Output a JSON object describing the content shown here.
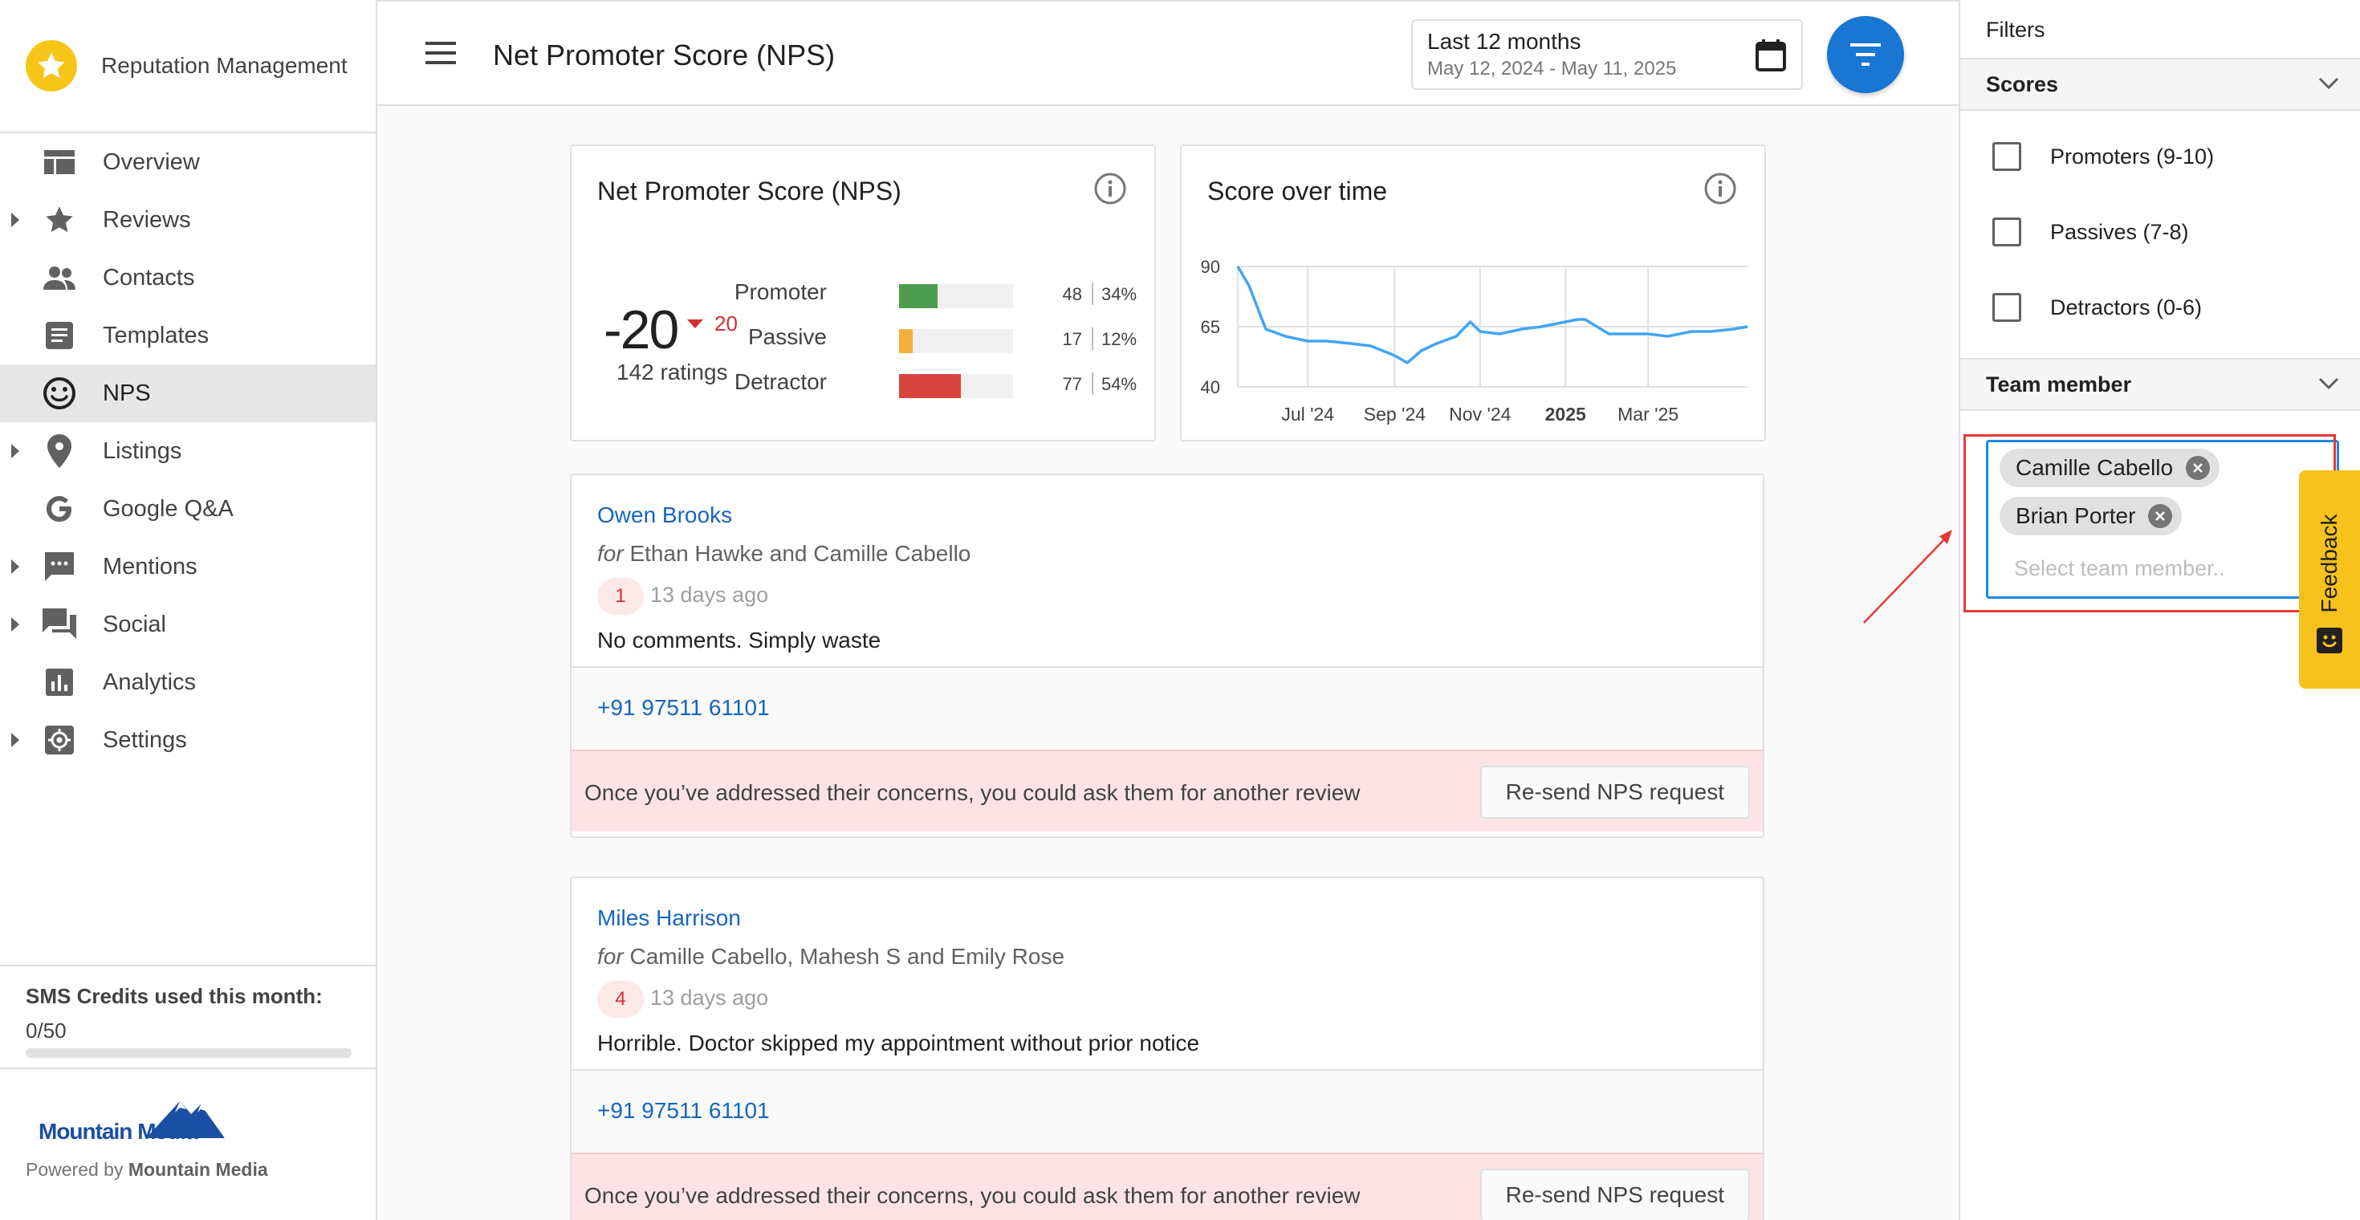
{
  "app": {
    "name": "Reputation Management"
  },
  "sidebar": {
    "items": [
      {
        "label": "Overview",
        "icon": "dashboard-icon",
        "expandable": false,
        "active": false
      },
      {
        "label": "Reviews",
        "icon": "star-icon",
        "expandable": true,
        "active": false
      },
      {
        "label": "Contacts",
        "icon": "people-icon",
        "expandable": false,
        "active": false
      },
      {
        "label": "Templates",
        "icon": "document-icon",
        "expandable": false,
        "active": false
      },
      {
        "label": "NPS",
        "icon": "smiley-icon",
        "expandable": false,
        "active": true
      },
      {
        "label": "Listings",
        "icon": "location-pin-icon",
        "expandable": true,
        "active": false
      },
      {
        "label": "Google Q&A",
        "icon": "google-icon",
        "expandable": false,
        "active": false
      },
      {
        "label": "Mentions",
        "icon": "chat-bubble-icon",
        "expandable": true,
        "active": false
      },
      {
        "label": "Social",
        "icon": "forum-icon",
        "expandable": true,
        "active": false
      },
      {
        "label": "Analytics",
        "icon": "bar-chart-icon",
        "expandable": false,
        "active": false
      },
      {
        "label": "Settings",
        "icon": "gear-icon",
        "expandable": true,
        "active": false
      }
    ],
    "sms": {
      "title": "SMS Credits used this month:",
      "value": "0/50",
      "used_fraction": 0
    },
    "footer": {
      "logo_text": "Mountain Media",
      "powered_prefix": "Powered by",
      "powered_name": "Mountain Media"
    }
  },
  "header": {
    "title": "Net Promoter Score (NPS)",
    "date_range": {
      "label": "Last 12 months",
      "sub": "May 12, 2024 - May 11, 2025"
    }
  },
  "nps_card": {
    "title": "Net Promoter Score (NPS)",
    "score": "-20",
    "delta": "20",
    "ratings": "142 ratings",
    "rows": [
      {
        "label": "Promoter",
        "count": "48",
        "pct": "34%",
        "fraction": 0.34,
        "color": "#4f9d4f"
      },
      {
        "label": "Passive",
        "count": "17",
        "pct": "12%",
        "fraction": 0.12,
        "color": "#f4b03e"
      },
      {
        "label": "Detractor",
        "count": "77",
        "pct": "54%",
        "fraction": 0.54,
        "color": "#d9443f"
      }
    ]
  },
  "score_card": {
    "title": "Score over time"
  },
  "chart_data": {
    "type": "line",
    "title": "Score over time",
    "xlabel": "",
    "ylabel": "",
    "x_ticks": [
      "Jul '24",
      "Sep '24",
      "Nov '24",
      "2025",
      "Mar '25"
    ],
    "y_ticks": [
      90,
      65,
      40
    ],
    "ylim": [
      40,
      90
    ],
    "grid": true,
    "color": "#42a5f5",
    "series": [
      {
        "x": [
          "2024-05-12",
          "2024-05-20",
          "2024-06-01",
          "2024-06-15",
          "2024-07-01",
          "2024-07-15",
          "2024-08-01",
          "2024-08-15",
          "2024-09-01",
          "2024-09-10",
          "2024-09-20",
          "2024-10-01",
          "2024-10-15",
          "2024-10-25",
          "2024-11-01",
          "2024-11-15",
          "2024-12-01",
          "2024-12-15",
          "2025-01-01",
          "2025-01-10",
          "2025-01-15",
          "2025-02-01",
          "2025-02-15",
          "2025-03-01",
          "2025-03-15",
          "2025-04-01",
          "2025-04-15",
          "2025-05-01",
          "2025-05-11"
        ],
        "values": [
          90,
          82,
          64,
          61,
          59,
          59,
          58,
          57,
          53,
          50,
          55,
          58,
          61,
          67,
          63,
          62,
          64,
          65,
          67,
          68,
          68,
          62,
          62,
          62,
          61,
          63,
          63,
          64,
          65
        ]
      }
    ]
  },
  "reviews": [
    {
      "name": "Owen Brooks",
      "for_prefix": "for",
      "for_names": "Ethan Hawke and Camille Cabello",
      "score": "1",
      "time": "13 days ago",
      "comment": "No comments. Simply waste",
      "phone": "+91 97511 61101",
      "note": "Once you’ve addressed their concerns, you could ask them for another review",
      "button": "Re-send NPS request"
    },
    {
      "name": "Miles Harrison",
      "for_prefix": "for",
      "for_names": "Camille Cabello, Mahesh S and Emily Rose",
      "score": "4",
      "time": "13 days ago",
      "comment": "Horrible. Doctor skipped my appointment without prior notice",
      "phone": "+91 97511 61101",
      "note": "Once you’ve addressed their concerns, you could ask them for another review",
      "button": "Re-send NPS request"
    }
  ],
  "filters": {
    "title": "Filters",
    "scores_label": "Scores",
    "score_options": [
      "Promoters (9-10)",
      "Passives (7-8)",
      "Detractors (0-6)"
    ],
    "team_label": "Team member",
    "team_selected": [
      "Camille Cabello",
      "Brian Porter"
    ],
    "team_placeholder": "Select team member..",
    "highlight_color": "#e53935"
  },
  "feedback": {
    "label": "Feedback"
  }
}
